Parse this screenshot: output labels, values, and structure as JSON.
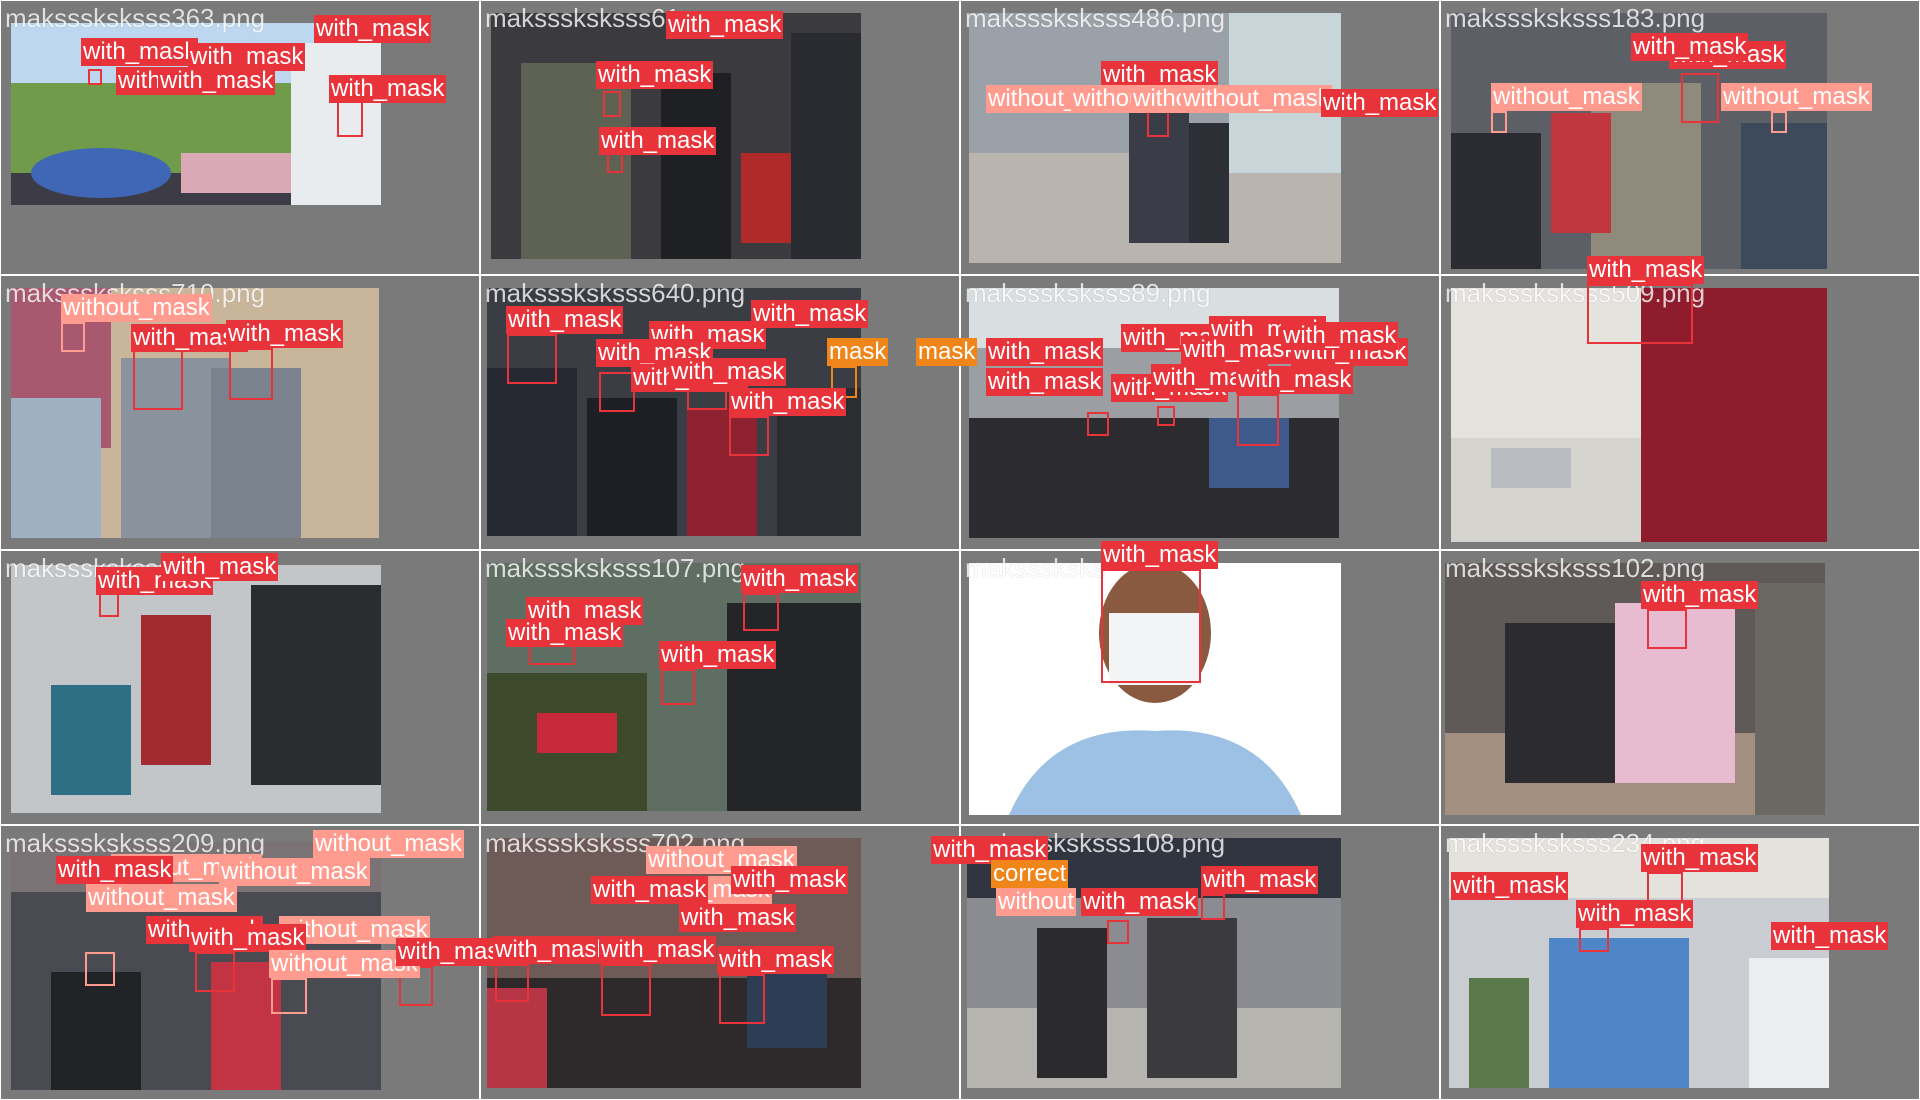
{
  "colors": {
    "with_mask": "#e8333a",
    "without_mask": "#ff9c8f",
    "mask_weared_incorrect": "#f08519",
    "tile_border": "#7a7a7a"
  },
  "tiles": [
    {
      "filename": "maksssksksss363.png",
      "labels": [
        "with_mask",
        "with_mask",
        "with_mask",
        "with_mask",
        "with_mask",
        "with_mask",
        "with_mask"
      ]
    },
    {
      "filename": "maksssksksss61",
      "labels": [
        "with_mask",
        "with_mask",
        "with_mask"
      ]
    },
    {
      "filename": "maksssksksss486.png",
      "labels": [
        "with_mask",
        "without_mask",
        "without_mask",
        "without_mask",
        "without_mask",
        "with_mask"
      ]
    },
    {
      "filename": "maksssksksss183.png",
      "labels": [
        "with_mask",
        "with_mask",
        "without_mask",
        "without_mask"
      ]
    },
    {
      "filename": "maksssksksss710.png",
      "labels": [
        "without_mask",
        "with_mask",
        "with_mask"
      ]
    },
    {
      "filename": "maksssksksss640.png",
      "labels": [
        "with_mask",
        "with_mask",
        "with_mask",
        "with_mask",
        "with_mask",
        "with_mask",
        "with_mask",
        "mask"
      ]
    },
    {
      "filename": "maksssksksss89.png",
      "labels": [
        "with_mask",
        "with_mask",
        "with_mask",
        "with_mask",
        "with_mask",
        "with_mask",
        "with_mask",
        "with_mask",
        "with_mask",
        "with_mask",
        "mask"
      ]
    },
    {
      "filename": "maksssksksss509.png",
      "labels": [
        "with_mask"
      ]
    },
    {
      "filename": "maksssksksss",
      "labels": [
        "with_mask",
        "with_mask"
      ]
    },
    {
      "filename": "maksssksksss107.png",
      "labels": [
        "with_mask",
        "with_mask",
        "with_mask",
        "with_mask"
      ]
    },
    {
      "filename": "maksssksks",
      "labels": [
        "with_mask"
      ]
    },
    {
      "filename": "maksssksksss102.png",
      "labels": [
        "with_mask"
      ]
    },
    {
      "filename": "maksssksksss209.png",
      "labels": [
        "without_mask",
        "without_mask",
        "without_mask",
        "without_mask",
        "without_mask",
        "with_mask",
        "with_mask",
        "without_mask",
        "with_mask",
        "with_mask"
      ]
    },
    {
      "filename": "maksssksksss702.png",
      "labels": [
        "without_mask",
        "without_mask",
        "with_mask",
        "with_mask",
        "with_mask",
        "with_mask",
        "with_mask",
        "with_mask"
      ]
    },
    {
      "filename": "maksssksksss108.png",
      "labels": [
        "with_mask",
        "correct",
        "without",
        "with_mask",
        "with_mask"
      ]
    },
    {
      "filename": "maksssksksss234.png",
      "labels": [
        "with_mask",
        "with_mask",
        "with_mask",
        "with_mask"
      ]
    }
  ]
}
